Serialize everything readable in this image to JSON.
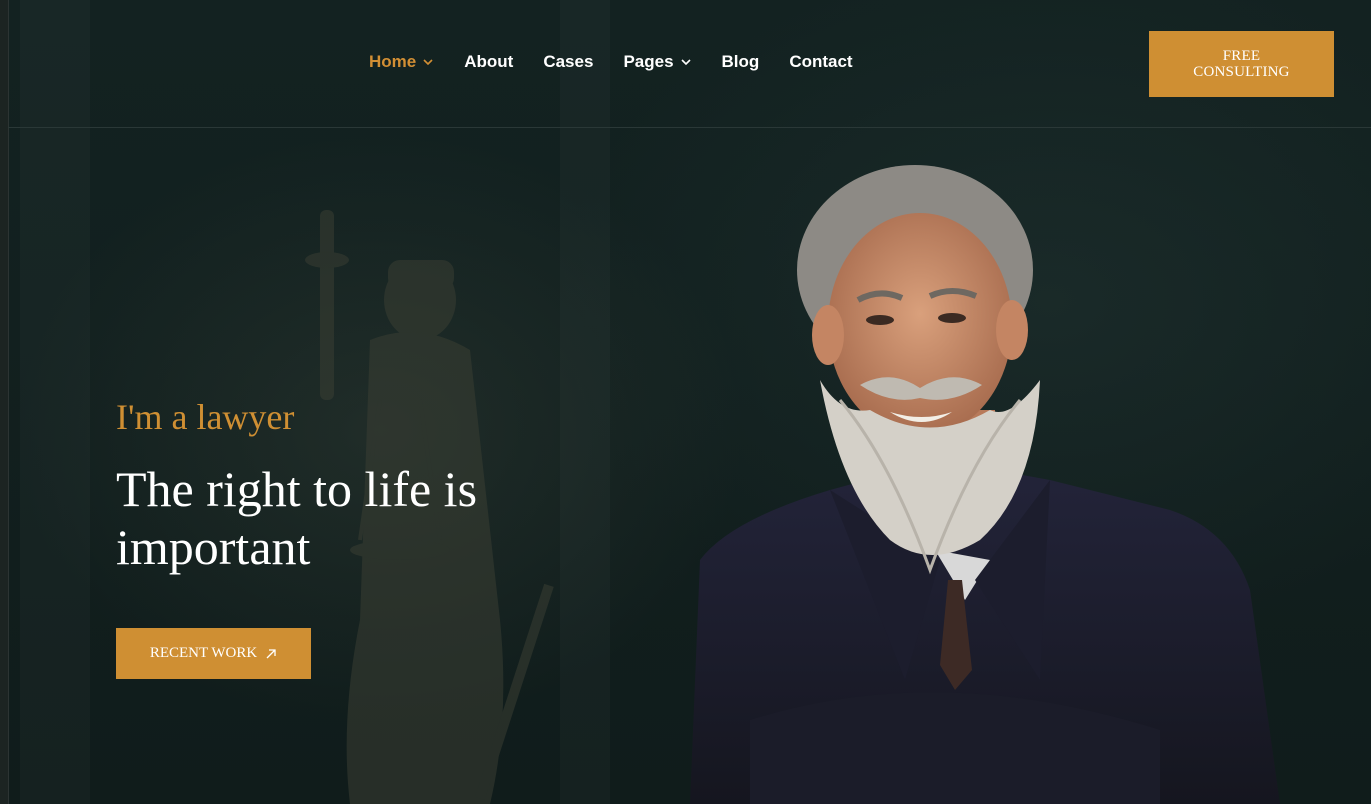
{
  "nav": {
    "items": [
      {
        "label": "Home",
        "has_dropdown": true,
        "active": true
      },
      {
        "label": "About",
        "has_dropdown": false,
        "active": false
      },
      {
        "label": "Cases",
        "has_dropdown": false,
        "active": false
      },
      {
        "label": "Pages",
        "has_dropdown": true,
        "active": false
      },
      {
        "label": "Blog",
        "has_dropdown": false,
        "active": false
      },
      {
        "label": "Contact",
        "has_dropdown": false,
        "active": false
      }
    ]
  },
  "cta": {
    "line1": "FREE",
    "line2": "CONSULTING"
  },
  "hero": {
    "subtitle": "I'm a lawyer",
    "title": "The right to life is important",
    "button_label": "RECENT WORK",
    "button_icon": "arrow-up-right-icon"
  },
  "colors": {
    "accent": "#cf8f33",
    "background": "#12201f",
    "text": "#ffffff"
  },
  "images": {
    "statue": "lady-justice-statue",
    "portrait": "smiling-bearded-lawyer-in-suit"
  }
}
